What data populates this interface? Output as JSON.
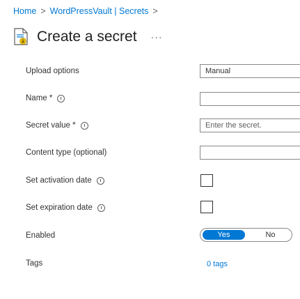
{
  "breadcrumb": {
    "home": "Home",
    "vault": "WordPressVault | Secrets",
    "separator": ">"
  },
  "header": {
    "title": "Create a secret",
    "more": "···",
    "icon": "secret-doc-icon"
  },
  "form": {
    "upload_options": {
      "label": "Upload options",
      "value": "Manual"
    },
    "name": {
      "label": "Name *",
      "value": ""
    },
    "secret_value": {
      "label": "Secret value *",
      "placeholder": "Enter the secret."
    },
    "content_type": {
      "label": "Content type (optional)",
      "value": ""
    },
    "activation_date": {
      "label": "Set activation date",
      "checked": false
    },
    "expiration_date": {
      "label": "Set expiration date",
      "checked": false
    },
    "enabled": {
      "label": "Enabled",
      "yes": "Yes",
      "no": "No",
      "selected": "Yes"
    },
    "tags": {
      "label": "Tags",
      "value": "0 tags"
    }
  },
  "colors": {
    "accent": "#0078d4",
    "text": "#323130"
  }
}
